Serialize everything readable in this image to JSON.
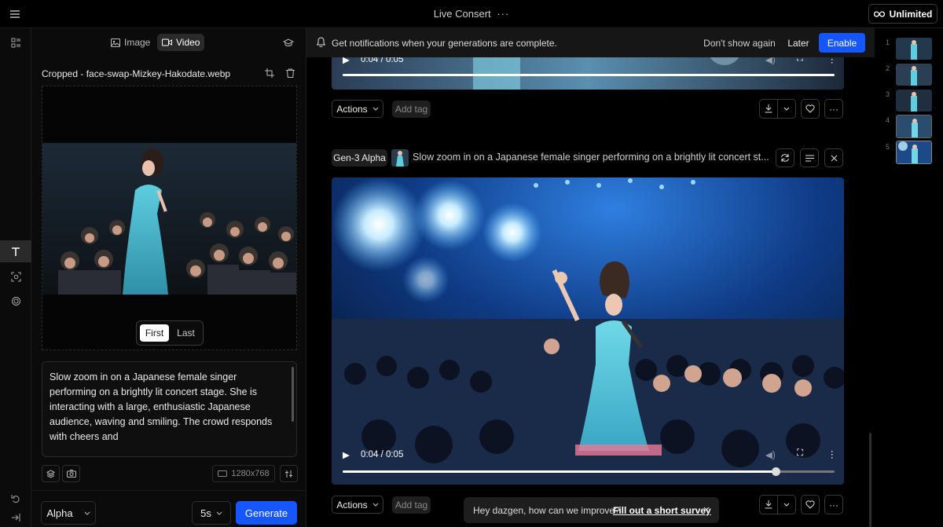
{
  "header": {
    "title": "Live Consert",
    "plan_label": "Unlimited"
  },
  "panel": {
    "tabs": [
      {
        "label": "Image"
      },
      {
        "label": "Video"
      }
    ],
    "filename": "Cropped - face-swap-Mizkey-Hakodate.webp",
    "frame_toggle": {
      "first": "First",
      "last": "Last",
      "selected": "First"
    },
    "prompt": "Slow zoom in on a Japanese female singer performing on a brightly lit concert stage. She is interacting with a large, enthusiastic Japanese audience, waving and smiling. The crowd responds with cheers and",
    "resolution": "1280x768",
    "model": "Alpha",
    "duration": "5s",
    "generate_label": "Generate"
  },
  "notification": {
    "text": "Get notifications when your generations are complete.",
    "dont_show": "Don't show again",
    "later": "Later",
    "enable": "Enable"
  },
  "cards": [
    {
      "time": "0:04 / 0:05",
      "actions_label": "Actions",
      "tag_label": "Add tag",
      "progress": 1.0
    },
    {
      "model_badge": "Gen-3 Alpha",
      "prompt_preview": "Slow zoom in on a Japanese female singer performing on a brightly lit concert st...",
      "time": "0:04 / 0:05",
      "actions_label": "Actions",
      "tag_label": "Add tag",
      "progress": 0.88
    }
  ],
  "thumbnails": [
    {
      "num": "1"
    },
    {
      "num": "2"
    },
    {
      "num": "3"
    },
    {
      "num": "4"
    },
    {
      "num": "5"
    }
  ],
  "toast": {
    "text": "Hey dazgen, how can we improve?",
    "link": "Fill out a short survey"
  },
  "colors": {
    "accent": "#1556ff",
    "background": "#000000",
    "panel": "#0b0b0b"
  }
}
